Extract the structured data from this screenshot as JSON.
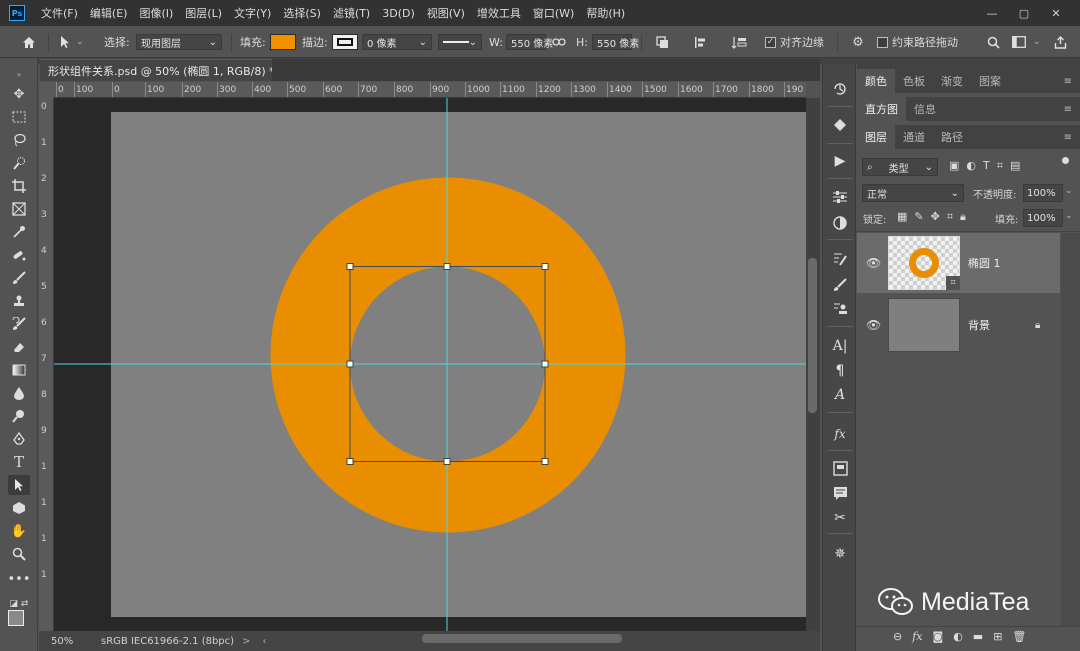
{
  "app": {
    "logo": "Ps"
  },
  "menu": [
    "文件(F)",
    "编辑(E)",
    "图像(I)",
    "图层(L)",
    "文字(Y)",
    "选择(S)",
    "滤镜(T)",
    "3D(D)",
    "视图(V)",
    "增效工具",
    "窗口(W)",
    "帮助(H)"
  ],
  "window_controls": {
    "minimize": "—",
    "restore": "▢",
    "close": "✕"
  },
  "options": {
    "select_label": "选择:",
    "select_value": "现用图层",
    "fill_label": "填充:",
    "fill_color": "#f29000",
    "stroke_label": "描边:",
    "stroke_width": "0 像素",
    "w_label": "W:",
    "w_value": "550 像素",
    "h_label": "H:",
    "h_value": "550 像素",
    "align_edges_label": "对齐边缘",
    "constrain_label": "约束路径拖动"
  },
  "document": {
    "tab_title": "形状组件关系.psd @ 50% (椭圆 1, RGB/8) *",
    "tab_close": "×"
  },
  "ruler": {
    "h_ticks": [
      "0",
      "100",
      "0",
      "100",
      "200",
      "300",
      "400",
      "500",
      "600",
      "700",
      "800",
      "900",
      "1000",
      "1100",
      "1200",
      "1300",
      "1400",
      "1500",
      "1600",
      "1700",
      "1800",
      "190"
    ],
    "v_ticks": [
      "0",
      "1",
      "2",
      "3",
      "4",
      "5",
      "6",
      "7",
      "8",
      "9",
      "1",
      "1",
      "1",
      "1"
    ]
  },
  "status": {
    "zoom": "50%",
    "profile": "sRGB IEC61966-2.1 (8bpc)",
    "arrow": ">"
  },
  "colors": {
    "shape": "#e98e00",
    "canvas": "#808080",
    "guide": "#4fd6e0"
  },
  "panels": {
    "top_tabs": [
      "颜色",
      "色板",
      "渐变",
      "图案"
    ],
    "mid_tabs": [
      "直方图",
      "信息"
    ],
    "layer_tabs": [
      "图层",
      "通道",
      "路径"
    ],
    "filter_kind": "类型",
    "blend_mode": "正常",
    "opacity_label": "不透明度:",
    "opacity_value": "100%",
    "lock_label": "锁定:",
    "fill_label": "填充:",
    "fill_value": "100%",
    "layers": [
      {
        "name": "椭圆 1",
        "selected": true
      },
      {
        "name": "背景",
        "selected": false
      }
    ]
  },
  "watermark": "MediaTea"
}
